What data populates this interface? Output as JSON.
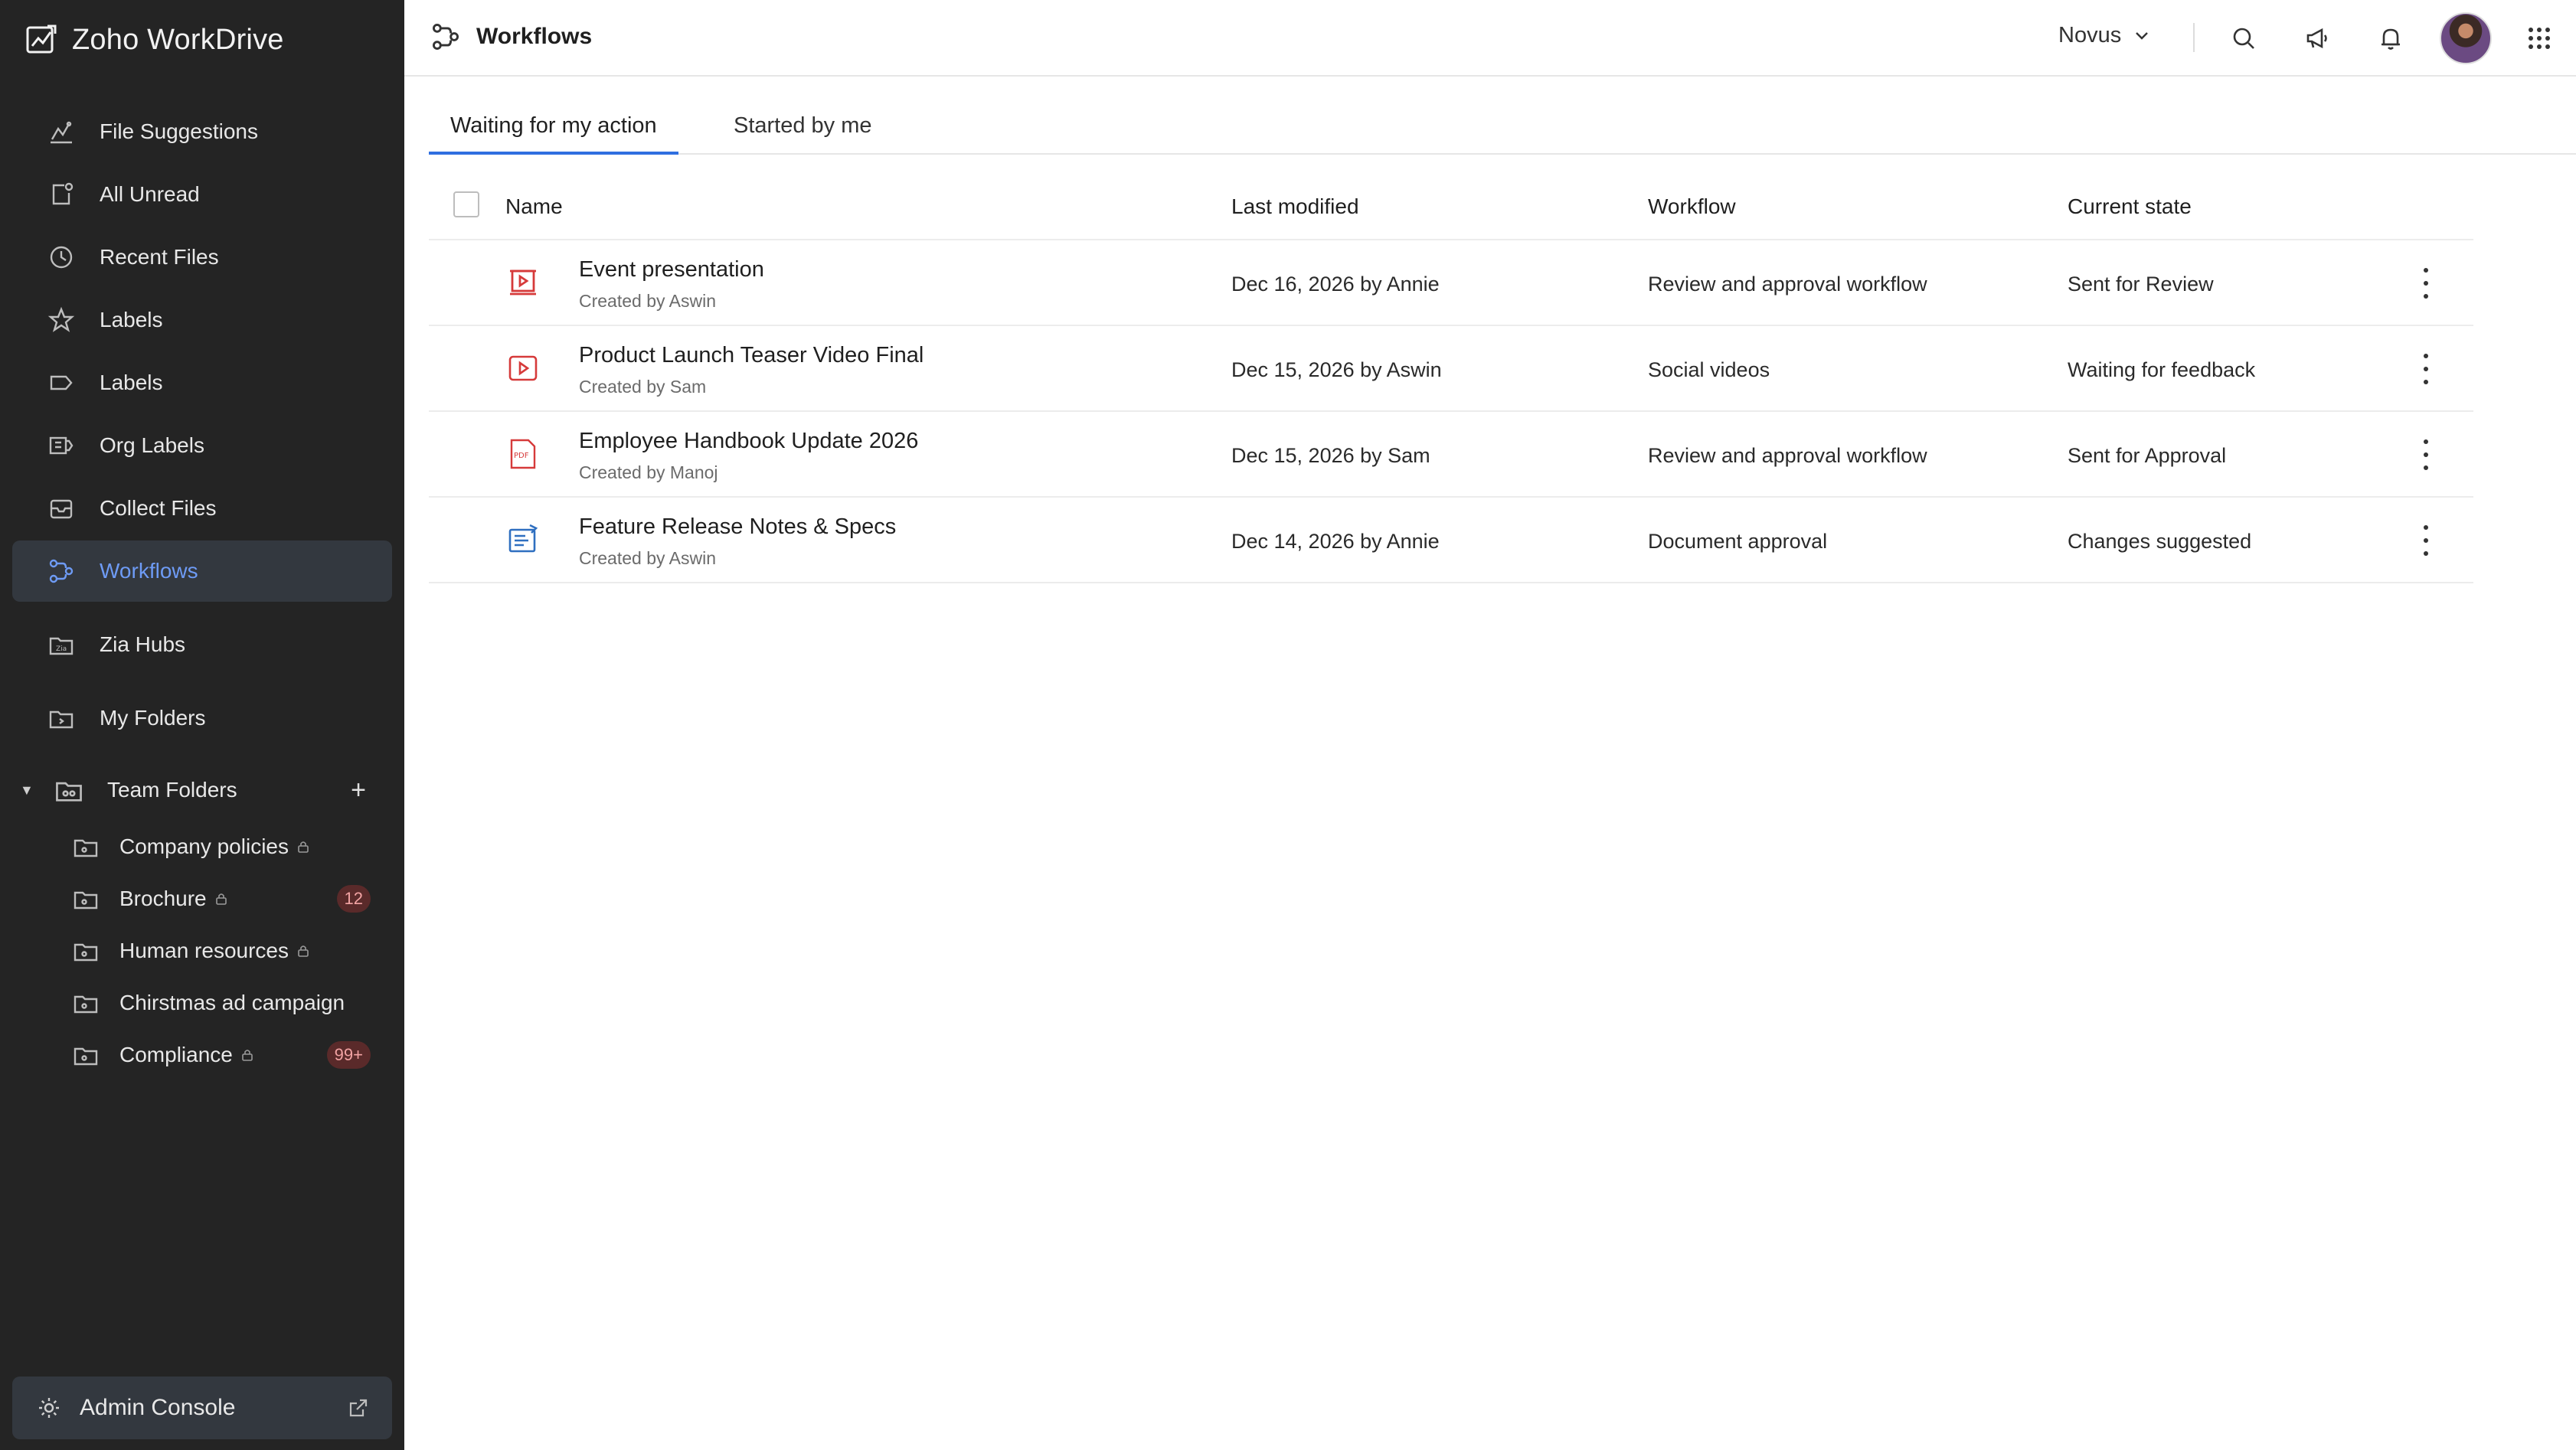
{
  "app": {
    "name": "Zoho WorkDrive"
  },
  "sidebar": {
    "items": [
      {
        "label": "File Suggestions",
        "icon": "file-suggestions-icon"
      },
      {
        "label": "All Unread",
        "icon": "unread-icon"
      },
      {
        "label": "Recent Files",
        "icon": "clock-icon"
      },
      {
        "label": "Labels",
        "icon": "star-icon"
      },
      {
        "label": "Labels",
        "icon": "label-tag-icon"
      },
      {
        "label": "Org Labels",
        "icon": "org-labels-icon"
      },
      {
        "label": "Collect Files",
        "icon": "collect-files-icon"
      },
      {
        "label": "Workflows",
        "icon": "workflows-icon",
        "active": true
      },
      {
        "label": "Zia Hubs",
        "icon": "zia-hubs-icon"
      },
      {
        "label": "My Folders",
        "icon": "my-folders-icon"
      }
    ],
    "team_folders": {
      "label": "Team Folders",
      "items": [
        {
          "label": "Company policies",
          "locked": true,
          "badge": ""
        },
        {
          "label": "Brochure",
          "locked": true,
          "badge": "12"
        },
        {
          "label": "Human resources",
          "locked": true,
          "badge": ""
        },
        {
          "label": "Chirstmas ad campaign",
          "locked": false,
          "badge": ""
        },
        {
          "label": "Compliance",
          "locked": true,
          "badge": "99+"
        }
      ]
    },
    "admin": {
      "label": "Admin Console"
    }
  },
  "header": {
    "title": "Workflows",
    "org": "Novus"
  },
  "tabs": [
    {
      "label": "Waiting for my action",
      "active": true
    },
    {
      "label": "Started by me",
      "active": false
    }
  ],
  "table": {
    "columns": {
      "name": "Name",
      "modified": "Last modified",
      "workflow": "Workflow",
      "state": "Current state"
    },
    "rows": [
      {
        "name": "Event presentation",
        "created_by": "Created by Aswin",
        "modified": "Dec 16, 2026 by Annie",
        "workflow": "Review and approval workflow",
        "state": "Sent for Review",
        "icon": "presentation-file-icon"
      },
      {
        "name": "Product Launch Teaser Video Final",
        "created_by": "Created by Sam",
        "modified": "Dec 15, 2026 by Aswin",
        "workflow": "Social videos",
        "state": "Waiting for feedback",
        "icon": "video-file-icon"
      },
      {
        "name": "Employee Handbook Update 2026",
        "created_by": "Created by Manoj",
        "modified": "Dec 15, 2026 by Sam",
        "workflow": "Review and approval workflow",
        "state": "Sent for Approval",
        "icon": "pdf-file-icon"
      },
      {
        "name": "Feature Release Notes & Specs",
        "created_by": "Created by Aswin",
        "modified": "Dec 14, 2026 by Annie",
        "workflow": "Document approval",
        "state": "Changes suggested",
        "icon": "document-file-icon"
      }
    ]
  },
  "colors": {
    "sidebar_bg": "#242424",
    "accent": "#2f6fe0",
    "active_text": "#6e9bf5"
  }
}
